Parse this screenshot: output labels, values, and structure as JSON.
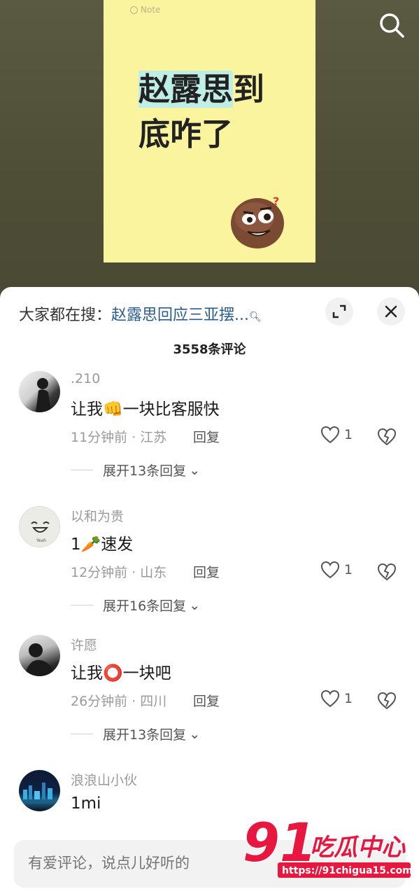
{
  "video": {
    "note_label": "Note",
    "note_line1_hl": "赵露思",
    "note_line1_rest": "到",
    "note_line2": "底咋了"
  },
  "sheet": {
    "trend_prefix": "大家都在搜：",
    "trend_link": "赵露思回应三亚摆...",
    "comment_count": "3558条评论",
    "input_placeholder": "有爱评论，说点儿好听的"
  },
  "comments": [
    {
      "user": ".210",
      "text_a": "让我",
      "emoji": "👊",
      "text_b": "一块比客服快",
      "meta": "11分钟前 · 江苏",
      "reply": "回复",
      "likes": "1",
      "expand": "展开13条回复"
    },
    {
      "user": "以和为贵",
      "text_a": "1",
      "emoji": "🥕",
      "text_b": "速发",
      "meta": "12分钟前 · 山东",
      "reply": "回复",
      "likes": "1",
      "expand": "展开16条回复"
    },
    {
      "user": "许愿",
      "text_a": "让我",
      "emoji": "⭕",
      "text_b": "一块吧",
      "meta": "26分钟前 · 四川",
      "reply": "回复",
      "likes": "1",
      "expand": "展开13条回复"
    },
    {
      "user": "浪浪山小伙",
      "text_a": "1mi"
    }
  ],
  "watermark": {
    "number": "91",
    "text": "吃瓜中心",
    "url": "https://91chigua15.com"
  },
  "colors": {
    "accent_link": "#2b5c8f",
    "note_bg": "#fbf49e",
    "watermark_red": "#e8173f"
  }
}
